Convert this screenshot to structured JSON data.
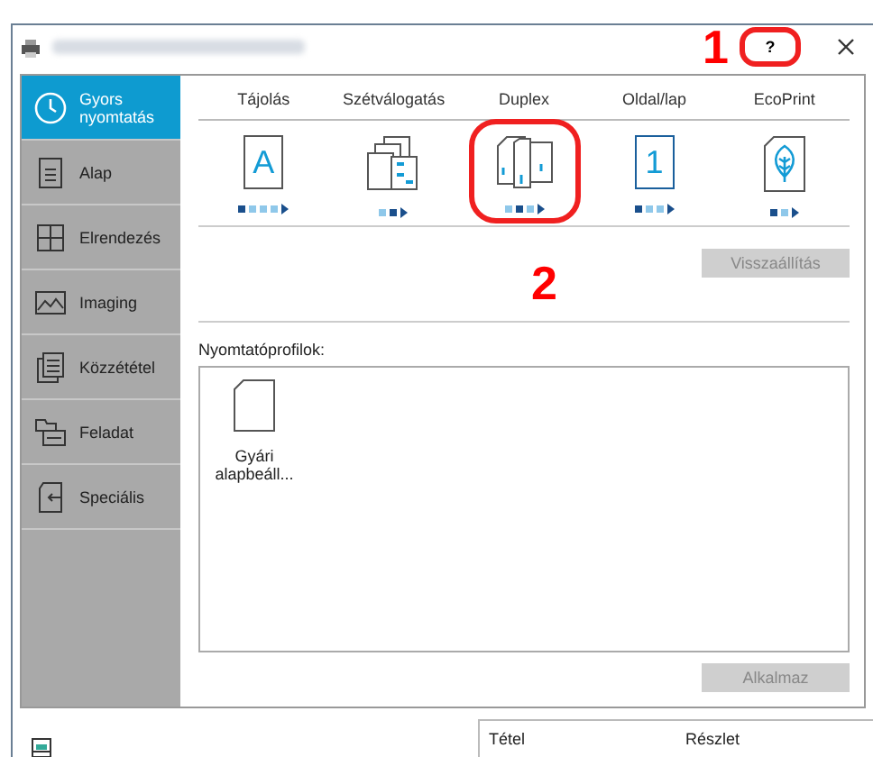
{
  "sidebar": {
    "items": [
      {
        "label": "Gyors nyomtatás",
        "kind": "clock",
        "selected": true
      },
      {
        "label": "Alap",
        "kind": "doc",
        "selected": false
      },
      {
        "label": "Elrendezés",
        "kind": "grid",
        "selected": false
      },
      {
        "label": "Imaging",
        "kind": "image",
        "selected": false
      },
      {
        "label": "Közzététel",
        "kind": "pages",
        "selected": false
      },
      {
        "label": "Feladat",
        "kind": "folder",
        "selected": false
      },
      {
        "label": "Speciális",
        "kind": "import",
        "selected": false
      }
    ]
  },
  "functions": [
    {
      "label": "Tájolás",
      "kind": "letter",
      "icon_text": "A",
      "options": [
        {
          "selected": true
        },
        {
          "selected": false
        },
        {
          "selected": false
        },
        {
          "selected": false
        }
      ],
      "highlighted": false
    },
    {
      "label": "Szétválogatás",
      "kind": "collate",
      "options": [
        {
          "selected": false
        },
        {
          "selected": true
        }
      ],
      "highlighted": false
    },
    {
      "label": "Duplex",
      "kind": "duplex",
      "options": [
        {
          "selected": false
        },
        {
          "selected": true
        },
        {
          "selected": false
        }
      ],
      "highlighted": true
    },
    {
      "label": "Oldal/lap",
      "kind": "number",
      "icon_text": "1",
      "options": [
        {
          "selected": true
        },
        {
          "selected": false
        },
        {
          "selected": false
        }
      ],
      "highlighted": false
    },
    {
      "label": "EcoPrint",
      "kind": "leaf",
      "options": [
        {
          "selected": true
        },
        {
          "selected": false
        }
      ],
      "highlighted": false
    }
  ],
  "reset_button": {
    "label": "Visszaállítás",
    "disabled": true
  },
  "profiles": {
    "label": "Nyomtatóprofilok:",
    "items": [
      {
        "label": "Gyári alapbeáll..."
      }
    ]
  },
  "apply_button": {
    "label": "Alkalmaz",
    "disabled": true
  },
  "help_button": {
    "label": "?",
    "highlighted": true
  },
  "callouts": [
    "1",
    "2"
  ],
  "details_table": {
    "columns": [
      "Tétel",
      "Részlet"
    ]
  }
}
